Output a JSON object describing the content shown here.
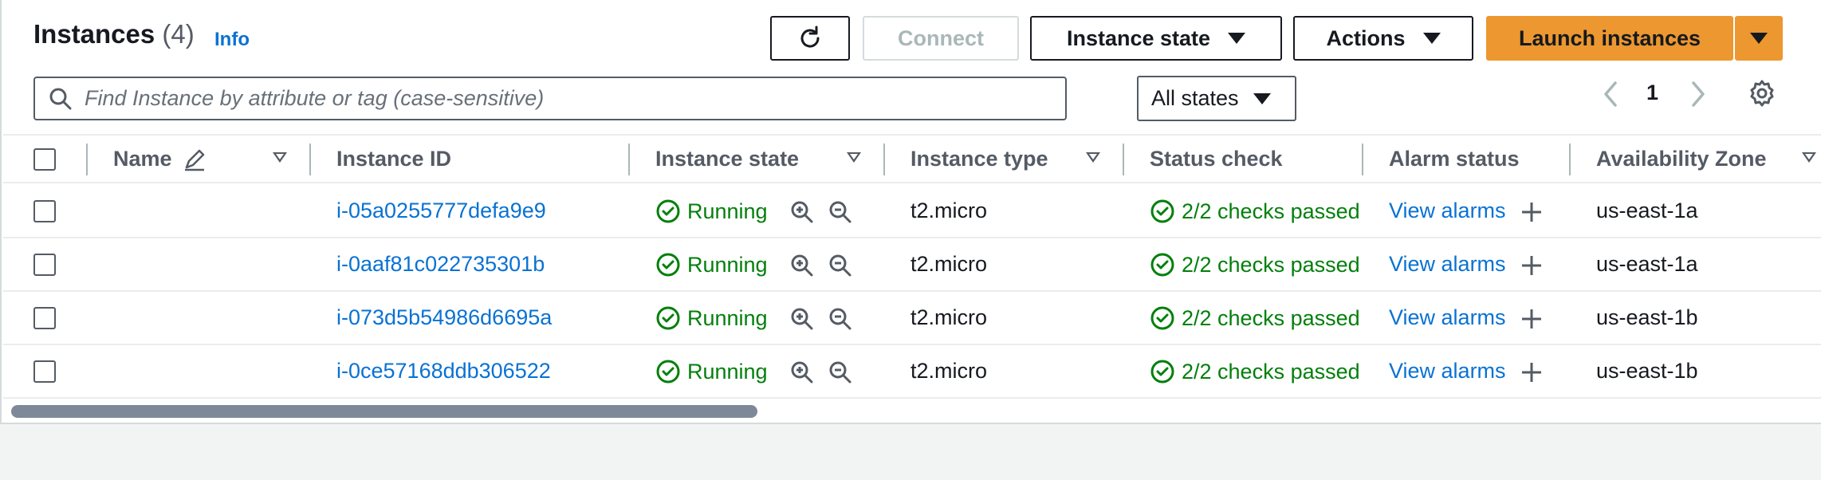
{
  "header": {
    "title": "Instances",
    "count": "(4)",
    "info_label": "Info",
    "refresh_icon": "refresh-icon",
    "connect_label": "Connect",
    "instance_state_label": "Instance state",
    "actions_label": "Actions",
    "launch_label": "Launch instances"
  },
  "search": {
    "placeholder": "Find Instance by attribute or tag (case-sensitive)",
    "value": ""
  },
  "filter": {
    "selected": "All states"
  },
  "pagination": {
    "current_page": "1"
  },
  "columns": {
    "name": "Name",
    "instance_id": "Instance ID",
    "instance_state": "Instance state",
    "instance_type": "Instance type",
    "status_check": "Status check",
    "alarm_status": "Alarm status",
    "availability_zone": "Availability Zone"
  },
  "rows": [
    {
      "name": "",
      "instance_id": "i-05a0255777defa9e9",
      "state": "Running",
      "type": "t2.micro",
      "status_check": "2/2 checks passed",
      "alarm": "View alarms",
      "zone": "us-east-1a"
    },
    {
      "name": "",
      "instance_id": "i-0aaf81c022735301b",
      "state": "Running",
      "type": "t2.micro",
      "status_check": "2/2 checks passed",
      "alarm": "View alarms",
      "zone": "us-east-1a"
    },
    {
      "name": "",
      "instance_id": "i-073d5b54986d6695a",
      "state": "Running",
      "type": "t2.micro",
      "status_check": "2/2 checks passed",
      "alarm": "View alarms",
      "zone": "us-east-1b"
    },
    {
      "name": "",
      "instance_id": "i-0ce57168ddb306522",
      "state": "Running",
      "type": "t2.micro",
      "status_check": "2/2 checks passed",
      "alarm": "View alarms",
      "zone": "us-east-1b"
    }
  ],
  "colors": {
    "primary_button": "#ec972f",
    "link": "#0972d3",
    "success": "#037f0c"
  }
}
